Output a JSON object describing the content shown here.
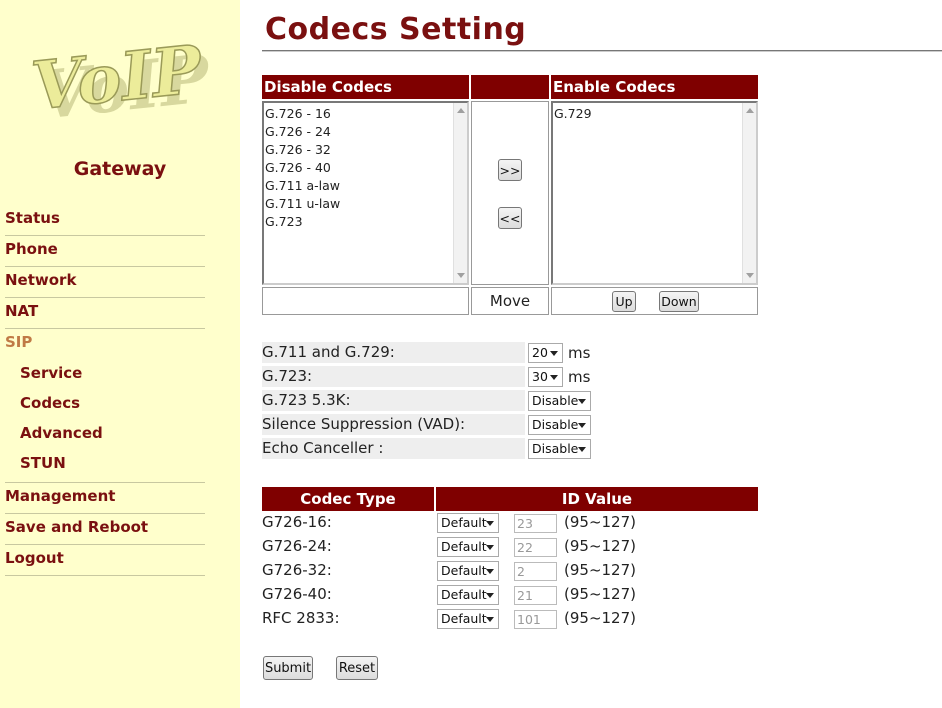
{
  "sidebar": {
    "logo_text": "VoIP",
    "brand": "Gateway",
    "nav": [
      {
        "label": "Status"
      },
      {
        "label": "Phone"
      },
      {
        "label": "Network"
      },
      {
        "label": "NAT"
      },
      {
        "label": "SIP",
        "active": true
      }
    ],
    "sip_sub": [
      {
        "label": "Service"
      },
      {
        "label": "Codecs"
      },
      {
        "label": "Advanced"
      },
      {
        "label": "STUN"
      }
    ],
    "nav_bottom": [
      {
        "label": "Management"
      },
      {
        "label": "Save and Reboot"
      },
      {
        "label": "Logout"
      }
    ]
  },
  "page": {
    "title": "Codecs Setting"
  },
  "codecs": {
    "disable_header": "Disable Codecs",
    "enable_header": "Enable Codecs",
    "disabled_list": [
      "G.726 - 16",
      "G.726 - 24",
      "G.726 - 32",
      "G.726 - 40",
      "G.711 a-law",
      "G.711 u-law",
      "G.723"
    ],
    "enabled_list": [
      "G.729"
    ],
    "move_right_label": ">>",
    "move_left_label": "<<",
    "move_label": "Move",
    "up_label": "Up",
    "down_label": "Down"
  },
  "settings": [
    {
      "label": "G.711 and G.729:",
      "value": "20",
      "unit": "ms"
    },
    {
      "label": "G.723:",
      "value": "30",
      "unit": "ms"
    },
    {
      "label": "G.723 5.3K:",
      "value": "Disable",
      "unit": ""
    },
    {
      "label": "Silence Suppression (VAD):",
      "value": "Disable",
      "unit": ""
    },
    {
      "label": "Echo Canceller :",
      "value": "Disable",
      "unit": ""
    }
  ],
  "id_table": {
    "col_type": "Codec Type",
    "col_id": "ID Value",
    "rows": [
      {
        "label": "G726-16:",
        "mode": "Default",
        "value": "23",
        "range": "(95~127)"
      },
      {
        "label": "G726-24:",
        "mode": "Default",
        "value": "22",
        "range": "(95~127)"
      },
      {
        "label": "G726-32:",
        "mode": "Default",
        "value": "2",
        "range": "(95~127)"
      },
      {
        "label": "G726-40:",
        "mode": "Default",
        "value": "21",
        "range": "(95~127)"
      },
      {
        "label": "RFC 2833:",
        "mode": "Default",
        "value": "101",
        "range": "(95~127)"
      }
    ]
  },
  "actions": {
    "submit": "Submit",
    "reset": "Reset"
  },
  "colors": {
    "sidebar_bg": "#ffffcc",
    "header_bg": "#7f0000",
    "accent_text": "#7a1010",
    "active_nav": "#c07a45"
  }
}
